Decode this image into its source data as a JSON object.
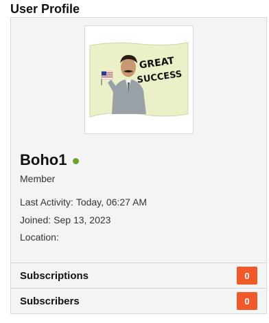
{
  "section": {
    "title": "User Profile"
  },
  "profile": {
    "avatar_text_line1": "GREAT",
    "avatar_text_line2": "SUCCESS",
    "username": "Boho1",
    "status_color": "#6aa22a",
    "role": "Member",
    "last_activity_label": "Last Activity:",
    "last_activity_value": "Today, 06:27 AM",
    "joined_label": "Joined:",
    "joined_value": "Sep 13, 2023",
    "location_label": "Location:",
    "location_value": ""
  },
  "links": {
    "subscriptions_label": "Subscriptions",
    "subscriptions_count": "0",
    "subscribers_label": "Subscribers",
    "subscribers_count": "0"
  },
  "colors": {
    "badge": "#f05a2a",
    "online": "#6aa22a"
  }
}
